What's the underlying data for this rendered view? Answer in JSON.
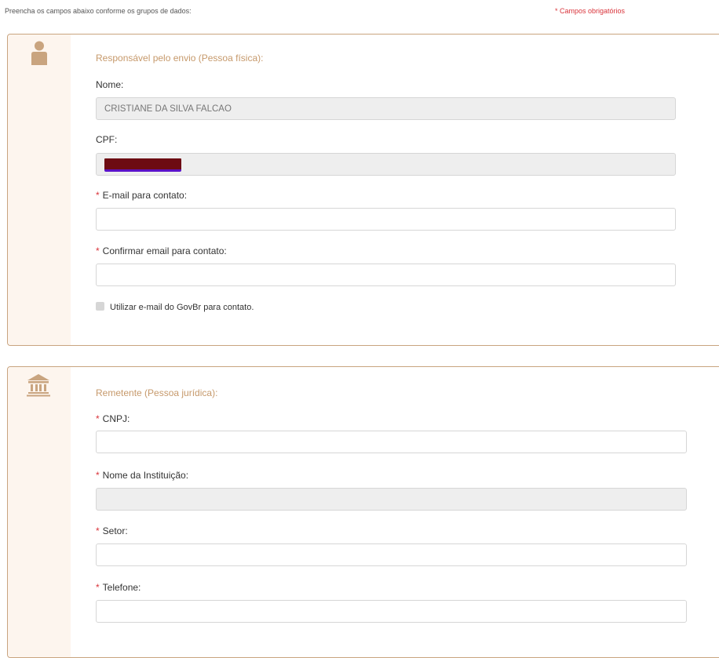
{
  "header": {
    "intro": "Preencha os campos abaixo conforme os grupos de dados:",
    "required_note": "* Campos obrigatórios"
  },
  "required_marker": "*",
  "responsavel": {
    "icon": "person-icon",
    "title": "Responsável pelo envio (Pessoa física):",
    "nome_label": "Nome:",
    "nome_value": "CRISTIANE DA SILVA FALCAO",
    "cpf_label": "CPF:",
    "email_label": "E-mail para contato:",
    "email_value": "",
    "confirm_email_label": "Confirmar email para contato:",
    "confirm_email_value": "",
    "govbr_checkbox_label": "Utilizar e-mail do GovBr para contato.",
    "govbr_checked": false
  },
  "remetente": {
    "icon": "institution-icon",
    "title": "Remetente (Pessoa jurídica):",
    "cnpj_label": "CNPJ:",
    "instituicao_label": "Nome da Instituição:",
    "setor_label": "Setor:",
    "telefone_label": "Telefone:"
  },
  "colors": {
    "accent": "#c6996b",
    "required": "#d9343b",
    "strip": "#fdf5ee",
    "border": "#c9a47f",
    "disabled": "#eeeeee"
  }
}
